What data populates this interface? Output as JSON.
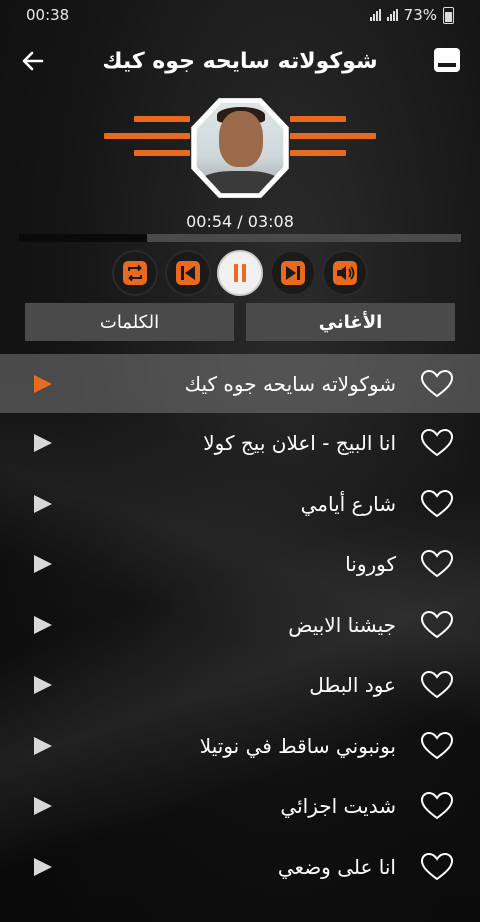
{
  "status": {
    "time": "00:38",
    "battery": "73%"
  },
  "header": {
    "title": "شوكولاته سايحه جوه كيك"
  },
  "player": {
    "time_display": "00:54 / 03:08",
    "progress_fraction": 0.29
  },
  "tabs": [
    {
      "label": "الكلمات",
      "active": false
    },
    {
      "label": "الأغاني",
      "active": true
    }
  ],
  "songs": [
    {
      "title": "شوكولاته سايحه جوه كيك",
      "active": true
    },
    {
      "title": "انا البيج - اعلان بيج كولا",
      "active": false
    },
    {
      "title": "شارع أيامي",
      "active": false
    },
    {
      "title": "كورونا",
      "active": false
    },
    {
      "title": "جيشنا الابيض",
      "active": false
    },
    {
      "title": "عود البطل",
      "active": false
    },
    {
      "title": "بونبوني ساقط في نوتيلا",
      "active": false
    },
    {
      "title": "شديت اجزائي",
      "active": false
    },
    {
      "title": "انا على وضعي",
      "active": false
    }
  ],
  "colors": {
    "accent": "#e86a1e",
    "active_play": "#e86a1e",
    "inactive_play": "#d8d8d8"
  }
}
